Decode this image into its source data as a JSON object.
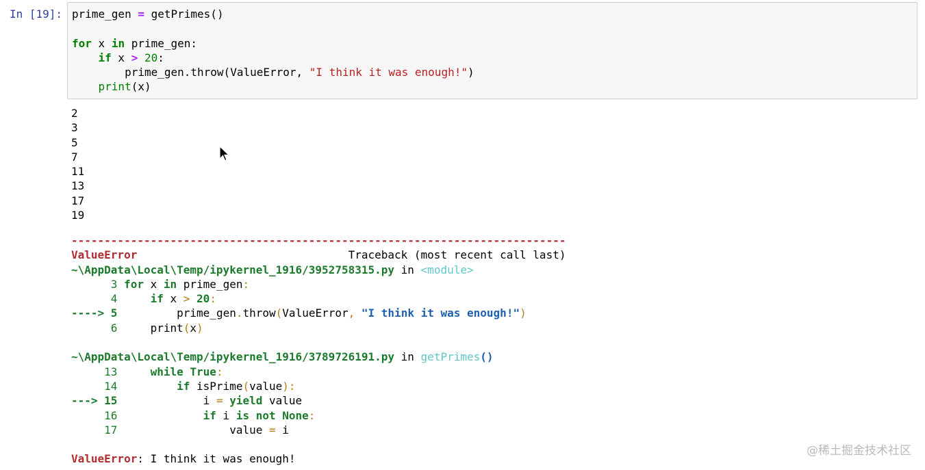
{
  "cell": {
    "prompt": "In [19]:",
    "code": {
      "l1_var": "prime_gen",
      "l1_eq": " = ",
      "l1_call": "getPrimes()",
      "l3_for": "for",
      "l3_x": " x ",
      "l3_in": "in",
      "l3_rest": " prime_gen:",
      "l4_indent": "    ",
      "l4_if": "if",
      "l4_x": " x ",
      "l4_gt": ">",
      "l4_num": " 20",
      "l4_colon": ":",
      "l5_indent": "        ",
      "l5_call": "prime_gen.throw(ValueError, ",
      "l5_str": "\"I think it was enough!\"",
      "l5_close": ")",
      "l6_indent": "    ",
      "l6_print": "print",
      "l6_rest": "(x)"
    }
  },
  "output": {
    "lines": [
      "2",
      "3",
      "5",
      "7",
      "11",
      "13",
      "17",
      "19"
    ]
  },
  "traceback": {
    "dashes": "---------------------------------------------------------------------------",
    "error_type": "ValueError",
    "header_tail": "                                Traceback (most recent call last)",
    "frame1_path": "~\\AppData\\Local\\Temp/ipykernel_1916/3952758315.py",
    "frame1_in": " in ",
    "frame1_func": "<module>",
    "f1_l3_num": "      3 ",
    "f1_l3_for": "for",
    "f1_l3_x": " x ",
    "f1_l3_in": "in",
    "f1_l3_rest": " prime_gen",
    "f1_l3_colon": ":",
    "f1_l4_num": "      4     ",
    "f1_l4_if": "if",
    "f1_l4_x": " x ",
    "f1_l4_gt": ">",
    "f1_l4_num2": " 20",
    "f1_l4_colon": ":",
    "f1_l5_arrow": "----> 5",
    "f1_l5_indent": "         ",
    "f1_l5_call": "prime_gen",
    "f1_l5_dot": ".",
    "f1_l5_throw": "throw",
    "f1_l5_open": "(",
    "f1_l5_arg": "ValueError",
    "f1_l5_comma": ", ",
    "f1_l5_str": "\"I think it was enough!\"",
    "f1_l5_close": ")",
    "f1_l6_num": "      6     ",
    "f1_l6_print": "print",
    "f1_l6_open": "(",
    "f1_l6_x": "x",
    "f1_l6_close": ")",
    "frame2_path": "~\\AppData\\Local\\Temp/ipykernel_1916/3789726191.py",
    "frame2_in": " in ",
    "frame2_func": "getPrimes",
    "frame2_paren": "()",
    "f2_l13_num": "     13     ",
    "f2_l13_while": "while",
    "f2_l13_true": " True",
    "f2_l13_colon": ":",
    "f2_l14_num": "     14         ",
    "f2_l14_if": "if",
    "f2_l14_call": " isPrime",
    "f2_l14_open": "(",
    "f2_l14_arg": "value",
    "f2_l14_close": ")",
    "f2_l14_colon": ":",
    "f2_l15_arrow": "---> 15",
    "f2_l15_indent": "             ",
    "f2_l15_i": "i ",
    "f2_l15_eq": "=",
    "f2_l15_yield": " yield",
    "f2_l15_val": " value",
    "f2_l16_num": "     16             ",
    "f2_l16_if": "if",
    "f2_l16_i": " i ",
    "f2_l16_is": "is",
    "f2_l16_not": " not",
    "f2_l16_none": " None",
    "f2_l16_colon": ":",
    "f2_l17_num": "     17                 ",
    "f2_l17_val": "value ",
    "f2_l17_eq": "=",
    "f2_l17_i": " i",
    "final_type": "ValueError",
    "final_msg": ": I think it was enough!"
  },
  "watermark": "@稀土掘金技术社区"
}
